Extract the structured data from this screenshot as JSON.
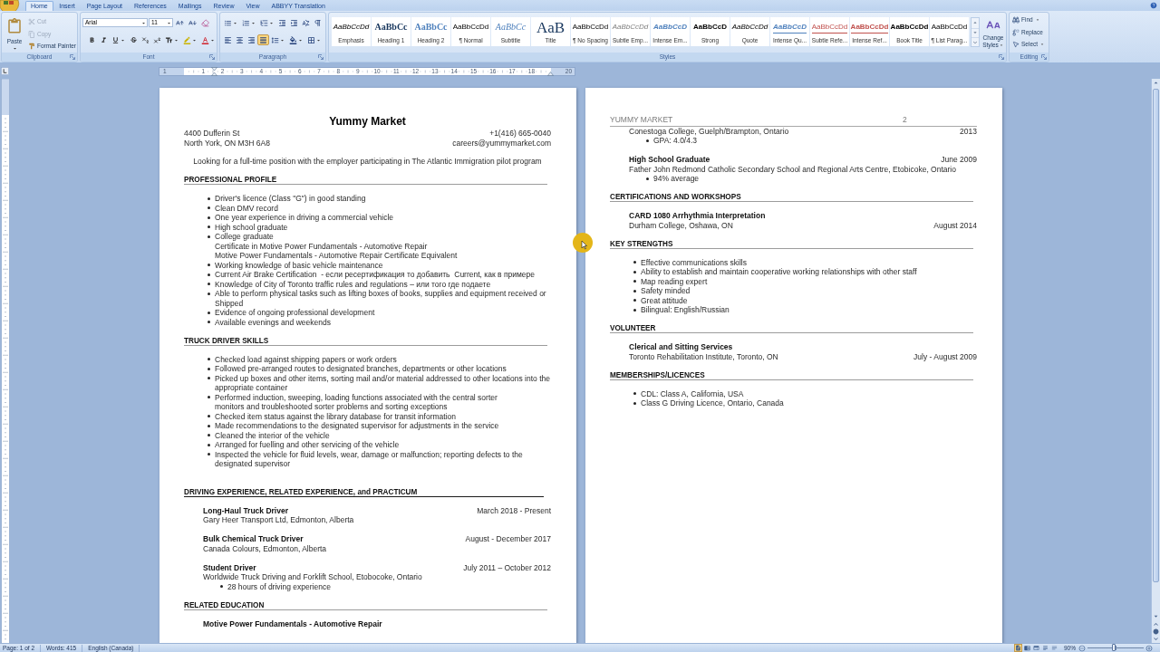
{
  "ribbon": {
    "tabs": [
      {
        "label": "Home",
        "selected": true
      },
      {
        "label": "Insert",
        "selected": false
      },
      {
        "label": "Page Layout",
        "selected": false
      },
      {
        "label": "References",
        "selected": false
      },
      {
        "label": "Mailings",
        "selected": false
      },
      {
        "label": "Review",
        "selected": false
      },
      {
        "label": "View",
        "selected": false
      },
      {
        "label": "ABBYY Translation",
        "selected": false
      }
    ],
    "clipboard": {
      "label": "Clipboard",
      "paste": "Paste",
      "items": [
        {
          "kind": "cut",
          "label": "Cut",
          "disabled": true
        },
        {
          "kind": "copy",
          "label": "Copy",
          "disabled": true
        },
        {
          "kind": "format_painter",
          "label": "Format Painter",
          "disabled": false
        }
      ]
    },
    "font": {
      "label": "Font",
      "font_name": "Arial",
      "font_size": "11"
    },
    "paragraph": {
      "label": "Paragraph",
      "alignment": [
        {
          "kind": "left",
          "selected": false
        },
        {
          "kind": "center",
          "selected": false
        },
        {
          "kind": "right",
          "selected": false
        },
        {
          "kind": "justify",
          "selected": true
        }
      ]
    },
    "styles": {
      "label": "Styles",
      "gallery": [
        {
          "kind": "emphasis",
          "preview": "AaBbCcDd",
          "label": "Emphasis"
        },
        {
          "kind": "heading1",
          "preview": "AaBbCc",
          "label": "Heading 1"
        },
        {
          "kind": "heading2",
          "preview": "AaBbCc",
          "label": "Heading 2"
        },
        {
          "kind": "normal",
          "preview": "AaBbCcDd",
          "label": "¶ Normal"
        },
        {
          "kind": "subtitle",
          "preview": "AaBbCc",
          "label": "Subtitle"
        },
        {
          "kind": "title",
          "preview": "AaB",
          "label": "Title"
        },
        {
          "kind": "no_spacing",
          "preview": "AaBbCcDd",
          "label": "¶ No Spacing"
        },
        {
          "kind": "subtle_emphasis",
          "preview": "AaBbCcDd",
          "label": "Subtle Emp..."
        },
        {
          "kind": "intense_emphasis",
          "preview": "AaBbCcD",
          "label": "Intense Em..."
        },
        {
          "kind": "strong",
          "preview": "AaBbCcD",
          "label": "Strong"
        },
        {
          "kind": "quote",
          "preview": "AaBbCcDd",
          "label": "Quote"
        },
        {
          "kind": "intense_quote",
          "preview": "AaBbCcD",
          "label": "Intense Qu..."
        },
        {
          "kind": "subtle_reference",
          "preview": "AaBbCcDd",
          "label": "Subtle Refe..."
        },
        {
          "kind": "intense_reference",
          "preview": "AaBbCcDd",
          "label": "Intense Ref..."
        },
        {
          "kind": "book_title",
          "preview": "AaBbCcDd",
          "label": "Book Title"
        },
        {
          "kind": "list_paragraph",
          "preview": "AaBbCcDd",
          "label": "¶ List Parag..."
        }
      ],
      "change_styles": "Change Styles"
    },
    "editing": {
      "label": "Editing",
      "items": [
        {
          "kind": "find",
          "label": "Find",
          "menu": true
        },
        {
          "kind": "replace",
          "label": "Replace",
          "menu": false
        },
        {
          "kind": "select",
          "label": "Select",
          "menu": true
        }
      ]
    }
  },
  "ruler": {
    "left_labels": [
      "1"
    ],
    "labels": [
      "1",
      "2",
      "3",
      "4",
      "5",
      "6",
      "7",
      "8",
      "9",
      "10",
      "11",
      "12",
      "13",
      "14",
      "15",
      "16",
      "17",
      "18"
    ],
    "right_labels": [
      "20"
    ]
  },
  "pages": [
    {
      "blocks": [
        {
          "kind": "title",
          "text": "Yummy Market"
        },
        {
          "kind": "contact",
          "left": [
            "4400 Dufferin St",
            "North York, ON M3H 6A8"
          ],
          "right": [
            "+1(416) 665-0040",
            "careers@yummymarket.com"
          ]
        },
        {
          "kind": "objective",
          "text": "Looking for a full-time position with the employer participating in The Atlantic Immigration pilot program"
        },
        {
          "kind": "heading",
          "text": "PROFESSIONAL PROFILE"
        },
        {
          "kind": "bullets",
          "items": [
            "Driver's licence (Class \"G\") in good standing",
            "Clean DMV record",
            "One year experience in driving a commercial vehicle",
            "High school graduate",
            "College graduate\nCertificate in Motive Power Fundamentals - Automotive Repair\nMotive Power Fundamentals - Automotive Repair Certificate Equivalent",
            "Working knowledge of basic vehicle maintenance",
            "Current Air Brake Certification  - если ресертификация то добавить  Current, как в примере",
            "Knowledge of City of Toronto traffic rules and regulations – или того где подаете",
            "Able to perform physical tasks such as lifting boxes of books, supplies and equipment received or\nShipped",
            "Evidence of ongoing professional development",
            "Available evenings and weekends"
          ]
        },
        {
          "kind": "heading",
          "text": "TRUCK DRIVER SKILLS"
        },
        {
          "kind": "bullets",
          "items": [
            "Checked load against shipping papers or work orders",
            "Followed pre-arranged routes to designated branches, departments or other locations",
            "Picked up boxes and other items, sorting mail and/or material addressed to other locations into the\nappropriate container",
            "Performed induction, sweeping, loading functions associated with the central sorter\nmonitors and troubleshooted sorter problems and sorting exceptions",
            "Checked item status against the library database for transit information",
            "Made recommendations to the designated supervisor for adjustments in the service",
            "Cleaned the interior of the vehicle",
            "Arranged for fuelling and other servicing of the vehicle",
            "Inspected the vehicle for fluid levels, wear, damage or malfunction; reporting defects to the\ndesignated supervisor"
          ]
        },
        {
          "kind": "major_heading",
          "text": "DRIVING EXPERIENCE, RELATED EXPERIENCE, and PRACTICUM"
        },
        {
          "kind": "entry",
          "title": "Long-Haul Truck Driver",
          "title_date": "March 2018 - Present",
          "place": "Gary Heer Transport Ltd, Edmonton, Alberta"
        },
        {
          "kind": "entry",
          "title": "Bulk Chemical Truck Driver",
          "title_date": "August - December 2017",
          "place": "Canada Colours, Edmonton, Alberta"
        },
        {
          "kind": "entry",
          "title": "Student Driver",
          "title_date": "July 2011 – October 2012",
          "place": "Worldwide Truck Driving and Forklift School, Etobocoke, Ontario",
          "bullets": [
            "28 hours of driving experience"
          ]
        },
        {
          "kind": "heading",
          "text": "RELATED EDUCATION"
        },
        {
          "kind": "entry",
          "title": "Motive Power Fundamentals - Automotive Repair"
        }
      ]
    },
    {
      "header": {
        "text": "YUMMY MARKET",
        "page_number": "2"
      },
      "blocks": [
        {
          "kind": "entry",
          "place": "Conestoga College, Guelph/Brampton, Ontario",
          "place_date": "2013",
          "bullets": [
            "GPA: 4.0/4.3"
          ]
        },
        {
          "kind": "entry",
          "title": "High School Graduate",
          "title_date": "June 2009",
          "place": "Father John Redmond Catholic Secondary School and Regional Arts Centre, Etobicoke, Ontario",
          "bullets": [
            "94% average"
          ]
        },
        {
          "kind": "heading",
          "text": "CERTIFICATIONS AND WORKSHOPS"
        },
        {
          "kind": "entry",
          "title": "CARD 1080 Arrhythmia Interpretation",
          "place": "Durham College, Oshawa, ON",
          "place_date": "August 2014"
        },
        {
          "kind": "heading",
          "text": "KEY STRENGTHS"
        },
        {
          "kind": "bullets",
          "items": [
            "Effective communications skills",
            "Ability to establish and maintain cooperative working relationships with other staff",
            "Map reading expert",
            "Safety minded",
            "Great attitude",
            "Bilingual: English/Russian"
          ]
        },
        {
          "kind": "heading",
          "text": "VOLUNTEER"
        },
        {
          "kind": "entry",
          "title": "Clerical and Sitting Services",
          "place": "Toronto Rehabilitation Institute, Toronto, ON",
          "place_date": "July - August 2009"
        },
        {
          "kind": "heading",
          "text": "MEMBERSHIPS/LICENCES"
        },
        {
          "kind": "bullets",
          "items": [
            "CDL: Class A, California, USA",
            "Class G Driving Licence, Ontario, Canada"
          ]
        }
      ]
    }
  ],
  "status_bar": {
    "page": "Page: 1 of 2",
    "words": "Words: 415",
    "language": "English (Canada)",
    "views": [
      {
        "kind": "print_layout",
        "selected": true
      },
      {
        "kind": "full_screen_reading",
        "selected": false
      },
      {
        "kind": "web_layout",
        "selected": false
      },
      {
        "kind": "outline",
        "selected": false
      },
      {
        "kind": "draft",
        "selected": false
      }
    ],
    "zoom": "90%",
    "zoom_slider": {
      "level": 0.47
    }
  }
}
